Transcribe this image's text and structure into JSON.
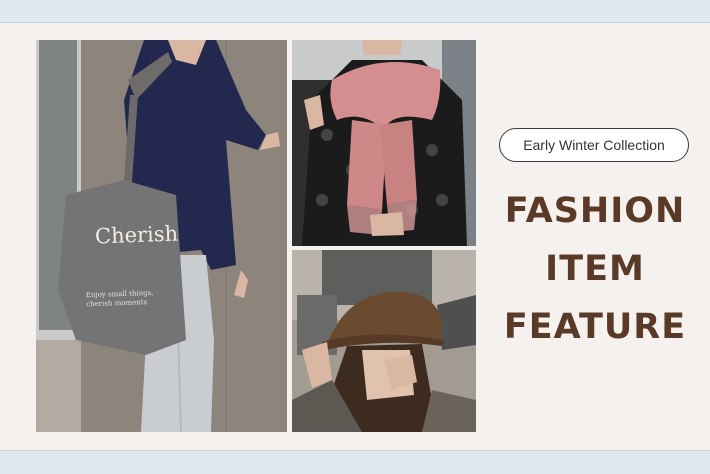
{
  "banner": {
    "collection_label": "Early Winter Collection",
    "headline_lines": [
      "FASHION",
      "ITEM",
      "FEATURE"
    ]
  },
  "photos": {
    "main_tote": {
      "brand": "Cherish",
      "motto": "Enjoy small things, cherish moments"
    }
  },
  "colors": {
    "panel_bg": "#f4f1ee",
    "band_bg": "#dfe7ef",
    "headline": "#5a3a27"
  }
}
